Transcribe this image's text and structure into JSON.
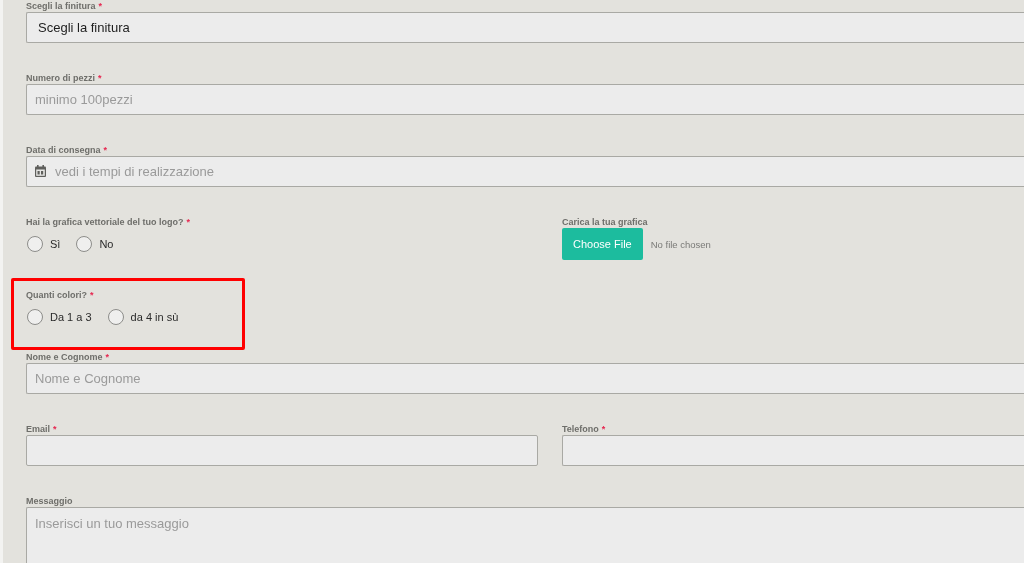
{
  "form": {
    "rows": [
      {
        "fields": [
          {
            "kind": "select",
            "label": "Scegli la finitura",
            "required_mark": "*",
            "value": "Scegli la finitura"
          }
        ]
      },
      {
        "fields": [
          {
            "kind": "text",
            "label": "Numero di pezzi",
            "required_mark": "*",
            "placeholder": "minimo 100pezzi"
          }
        ]
      },
      {
        "fields": [
          {
            "kind": "date",
            "label": "Data di consegna",
            "required_mark": "*",
            "placeholder": "vedi i tempi di realizzazione"
          }
        ]
      },
      {
        "fields": [
          {
            "kind": "radio",
            "label": "Hai la grafica vettoriale del tuo logo?",
            "required_mark": "*",
            "options": [
              {
                "label": "Sì",
                "selected": false
              },
              {
                "label": "No",
                "selected": false
              }
            ]
          },
          {
            "kind": "file",
            "label": "Carica la tua grafica",
            "button": "Choose File",
            "status": "No file chosen"
          }
        ]
      },
      {
        "fields": [
          {
            "kind": "radio",
            "label": "Quanti colori?",
            "required_mark": "*",
            "highlighted": true,
            "options": [
              {
                "label": "Da 1 a 3",
                "selected": false
              },
              {
                "label": "da 4 in sù",
                "selected": false
              }
            ]
          }
        ]
      },
      {
        "fields": [
          {
            "kind": "text",
            "label": "Nome e Cognome",
            "required_mark": "*",
            "placeholder": "Nome e Cognome"
          }
        ]
      },
      {
        "fields": [
          {
            "kind": "text",
            "label": "Email",
            "required_mark": "*"
          },
          {
            "kind": "text",
            "label": "Telefono",
            "required_mark": "*"
          }
        ]
      },
      {
        "fields": [
          {
            "kind": "textarea",
            "label": "Messaggio",
            "placeholder": "Inserisci un tuo messaggio"
          }
        ]
      }
    ]
  }
}
